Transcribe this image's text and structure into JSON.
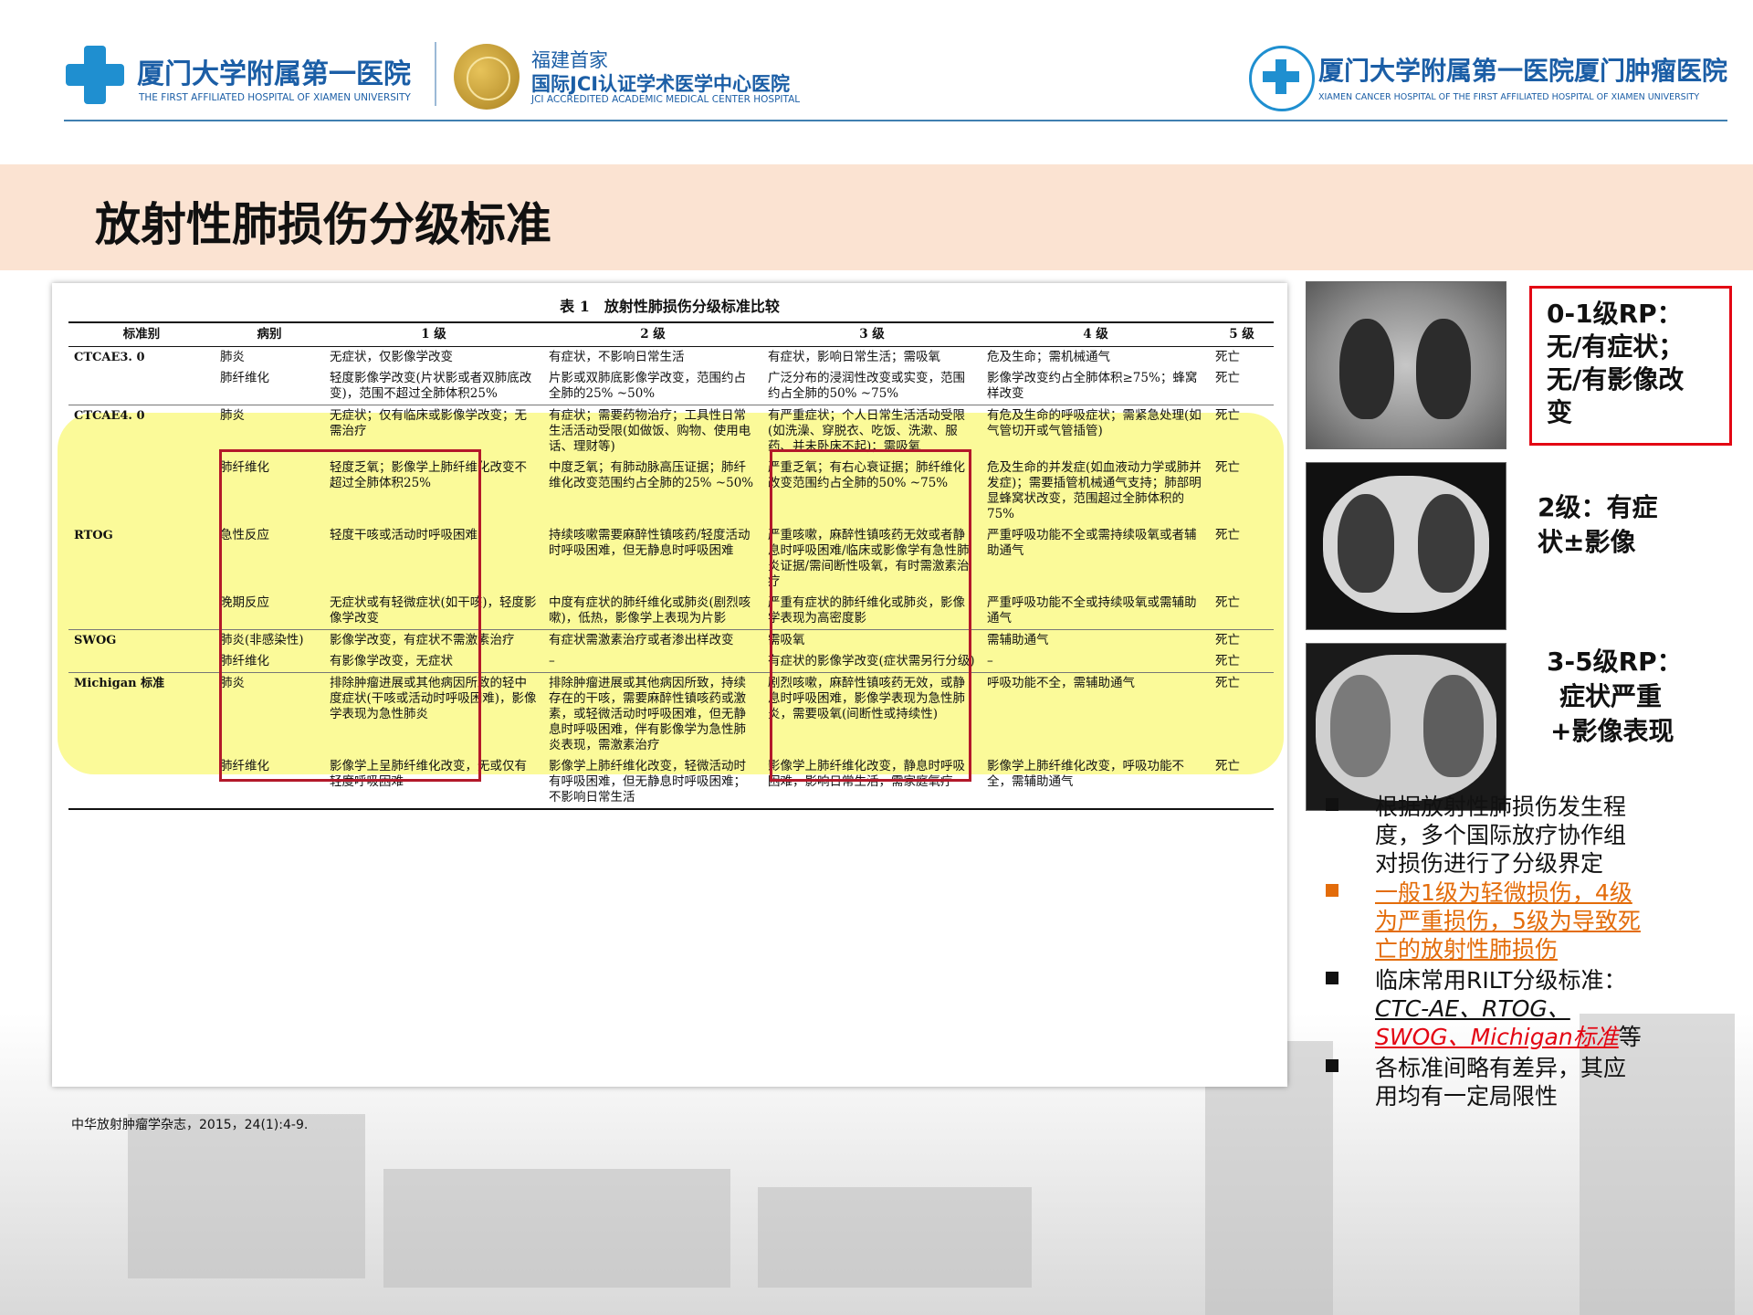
{
  "header": {
    "left_logo": {
      "name_cn": "厦门大学附属第一医院",
      "name_en": "THE FIRST AFFILIATED HOSPITAL OF XIAMEN UNIVERSITY"
    },
    "jci": {
      "line1": "福建首家",
      "line2": "国际JCI认证学术医学中心医院",
      "line3": "JCI ACCREDITED ACADEMIC MEDICAL CENTER HOSPITAL"
    },
    "right_logo": {
      "name_cn": "厦门大学附属第一医院厦门肿瘤医院",
      "name_en": "XIAMEN CANCER HOSPITAL OF THE FIRST AFFILIATED HOSPITAL OF XIAMEN UNIVERSITY"
    }
  },
  "title": "放射性肺损伤分级标准",
  "table": {
    "caption": "表 1　放射性肺损伤分级标准比较",
    "headers": [
      "标准别",
      "病别",
      "1 级",
      "2 级",
      "3 级",
      "4 级",
      "5 级"
    ],
    "rows": [
      [
        "CTCAE3. 0",
        "肺炎",
        "无症状，仅影像学改变",
        "有症状，不影响日常生活",
        "有症状，影响日常生活；需吸氧",
        "危及生命；需机械通气",
        "死亡"
      ],
      [
        "",
        "肺纤维化",
        "轻度影像学改变(片状影或者双肺底改变)，范围不超过全肺体积25%",
        "片影或双肺底影像学改变，范围约占全肺的25% ~50%",
        "广泛分布的浸润性改变或实变，范围约占全肺的50% ~75%",
        "影像学改变约占全肺体积≥75%；蜂窝样改变",
        "死亡"
      ],
      [
        "CTCAE4. 0",
        "肺炎",
        "无症状；仅有临床或影像学改变；无需治疗",
        "有症状；需要药物治疗；工具性日常生活活动受限(如做饭、购物、使用电话、理财等)",
        "有严重症状；个人日常生活活动受限(如洗澡、穿脱衣、吃饭、洗漱、服药、并未卧床不起)；需吸氧",
        "有危及生命的呼吸症状；需紧急处理(如气管切开或气管插管)",
        "死亡"
      ],
      [
        "",
        "肺纤维化",
        "轻度乏氧；影像学上肺纤维化改变不超过全肺体积25%",
        "中度乏氧；有肺动脉高压证据；肺纤维化改变范围约占全肺的25% ~50%",
        "严重乏氧；有右心衰证据；肺纤维化改变范围约占全肺的50% ~75%",
        "危及生命的并发症(如血液动力学或肺并发症)；需要插管机械通气支持；肺部明显蜂窝状改变，范围超过全肺体积的75%",
        "死亡"
      ],
      [
        "RTOG",
        "急性反应",
        "轻度干咳或活动时呼吸困难",
        "持续咳嗽需要麻醉性镇咳药/轻度活动时呼吸困难，但无静息时呼吸困难",
        "严重咳嗽，麻醉性镇咳药无效或者静息时呼吸困难/临床或影像学有急性肺炎证据/需间断性吸氧，有时需激素治疗",
        "严重呼吸功能不全或需持续吸氧或者辅助通气",
        "死亡"
      ],
      [
        "",
        "晚期反应",
        "无症状或有轻微症状(如干咳)，轻度影像学改变",
        "中度有症状的肺纤维化或肺炎(剧烈咳嗽)，低热，影像学上表现为片影",
        "严重有症状的肺纤维化或肺炎，影像学表现为高密度影",
        "严重呼吸功能不全或持续吸氧或需辅助通气",
        "死亡"
      ],
      [
        "SWOG",
        "肺炎(非感染性)",
        "影像学改变，有症状不需激素治疗",
        "有症状需激素治疗或者渗出样改变",
        "需吸氧",
        "需辅助通气",
        "死亡"
      ],
      [
        "",
        "肺纤维化",
        "有影像学改变，无症状",
        "–",
        "有症状的影像学改变(症状需另行分级)",
        "–",
        "死亡"
      ],
      [
        "Michigan 标准",
        "肺炎",
        "排除肿瘤进展或其他病因所致的轻中度症状(干咳或活动时呼吸困难)，影像学表现为急性肺炎",
        "排除肿瘤进展或其他病因所致，持续存在的干咳，需要麻醉性镇咳药或激素，或轻微活动时呼吸困难，但无静息时呼吸困难，伴有影像学为急性肺炎表现，需激素治疗",
        "剧烈咳嗽，麻醉性镇咳药无效，或静息时呼吸困难，影像学表现为急性肺炎，需要吸氧(间断性或持续性)",
        "呼吸功能不全，需辅助通气",
        "死亡"
      ],
      [
        "",
        "肺纤维化",
        "影像学上呈肺纤维化改变，无或仅有轻度呼吸困难",
        "影像学上肺纤维化改变，轻微活动时有呼吸困难，但无静息时呼吸困难；不影响日常生活",
        "影像学上肺纤维化改变，静息时呼吸困难，影响日常生活，需家庭氧疗",
        "影像学上肺纤维化改变，呼吸功能不全，需辅助通气",
        "死亡"
      ]
    ]
  },
  "reference": "中华放射肿瘤学杂志，2015，24(1):4-9.",
  "grades": {
    "g01": [
      "0-1级RP：",
      "无/有症状；",
      "无/有影像改",
      "变"
    ],
    "g2": [
      "2级：有症",
      "状±影像"
    ],
    "g35": [
      "3-5级RP：",
      "症状严重",
      "+影像表现"
    ]
  },
  "bullets": {
    "b1": [
      "根据放射性肺损伤发生程",
      "度，多个国际放疗协作组",
      "对损伤进行了分级界定"
    ],
    "b2": [
      "一般1级为轻微损伤，4级",
      "为严重损伤，5级为导致死",
      "亡的放射性肺损伤"
    ],
    "b3_line1": "临床常用RILT分级标准：",
    "b3_line2": "CTC-AE、RTOG、",
    "b3_line3_red": "SWOG、Michigan标准",
    "b3_line3_tail": "等",
    "b4": [
      "各标准间略有差异，其应",
      "用均有一定局限性"
    ]
  },
  "colors": {
    "accent_red": "#e30613",
    "highlight": "#fbfa99",
    "title_band": "#fbe3d2",
    "logo_blue": "#1b5ea6",
    "orange": "#e36c0a"
  }
}
